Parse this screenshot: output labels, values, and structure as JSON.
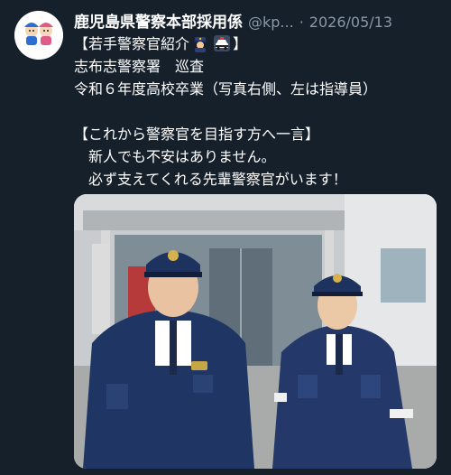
{
  "post": {
    "display_name": "鹿児島県警察本部採用係",
    "handle": "@kp...",
    "separator": "·",
    "date": "2026/05/13",
    "lines": [
      "【若手警察官紹介",
      "志布志警察署　巡査",
      "令和６年度高校卒業（写真右側、左は指導員）",
      "",
      "【これから警察官を目指す方へ一言】",
      "　新人でも不安はありません。",
      "　必ず支えてくれる先輩警察官がいます！"
    ],
    "line1_suffix": "】",
    "emojis": [
      "police-officer-emoji",
      "police-car-emoji"
    ],
    "avatar_caption": "鹿児島県警",
    "photo_alt": "police officers in front of station"
  },
  "colors": {
    "background": "#15202b",
    "text": "#ffffff",
    "muted": "#8b98a5",
    "uniform": "#1f3563"
  }
}
